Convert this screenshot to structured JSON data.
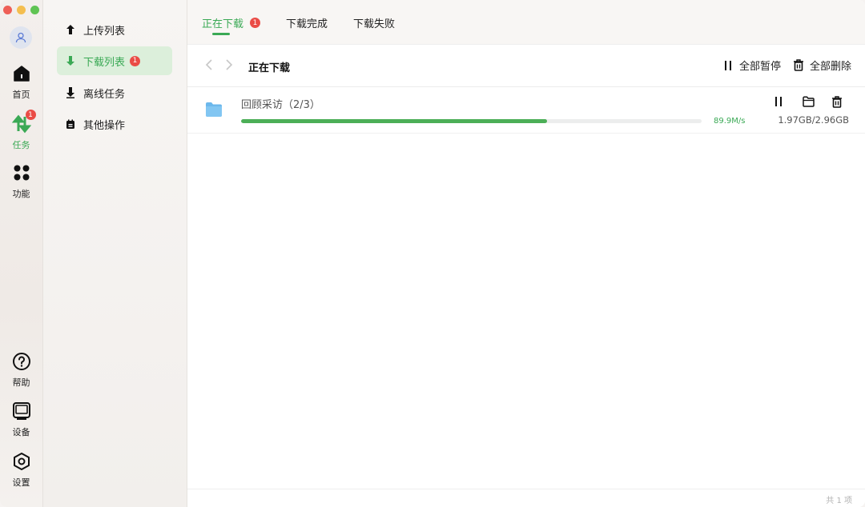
{
  "rail": {
    "items": [
      {
        "label": "首页",
        "icon": "home-icon"
      },
      {
        "label": "任务",
        "icon": "transfer-icon",
        "badge": "1"
      },
      {
        "label": "功能",
        "icon": "apps-icon"
      }
    ],
    "bottom": [
      {
        "label": "帮助",
        "icon": "help-icon"
      },
      {
        "label": "设备",
        "icon": "device-icon"
      },
      {
        "label": "设置",
        "icon": "settings-icon"
      }
    ]
  },
  "sidebar": {
    "items": [
      {
        "label": "上传列表",
        "icon": "upload-icon"
      },
      {
        "label": "下载列表",
        "icon": "download-icon",
        "badge": "1"
      },
      {
        "label": "离线任务",
        "icon": "offline-download-icon"
      },
      {
        "label": "其他操作",
        "icon": "other-ops-icon"
      }
    ]
  },
  "tabs": [
    {
      "label": "正在下载",
      "badge": "1"
    },
    {
      "label": "下载完成"
    },
    {
      "label": "下载失败"
    }
  ],
  "toolbar": {
    "title": "正在下载",
    "pause_all": "全部暂停",
    "delete_all": "全部删除"
  },
  "downloads": [
    {
      "name": "回顾采访（2/3）",
      "speed": "89.9M/s",
      "size": "1.97GB/2.96GB",
      "progress": 0.665
    }
  ],
  "footer": {
    "count_text": "共 1 项"
  },
  "colors": {
    "accent": "#3aa955",
    "badge": "#ea4c46",
    "folder": "#6cb8ec",
    "progress": "#4caf57"
  }
}
